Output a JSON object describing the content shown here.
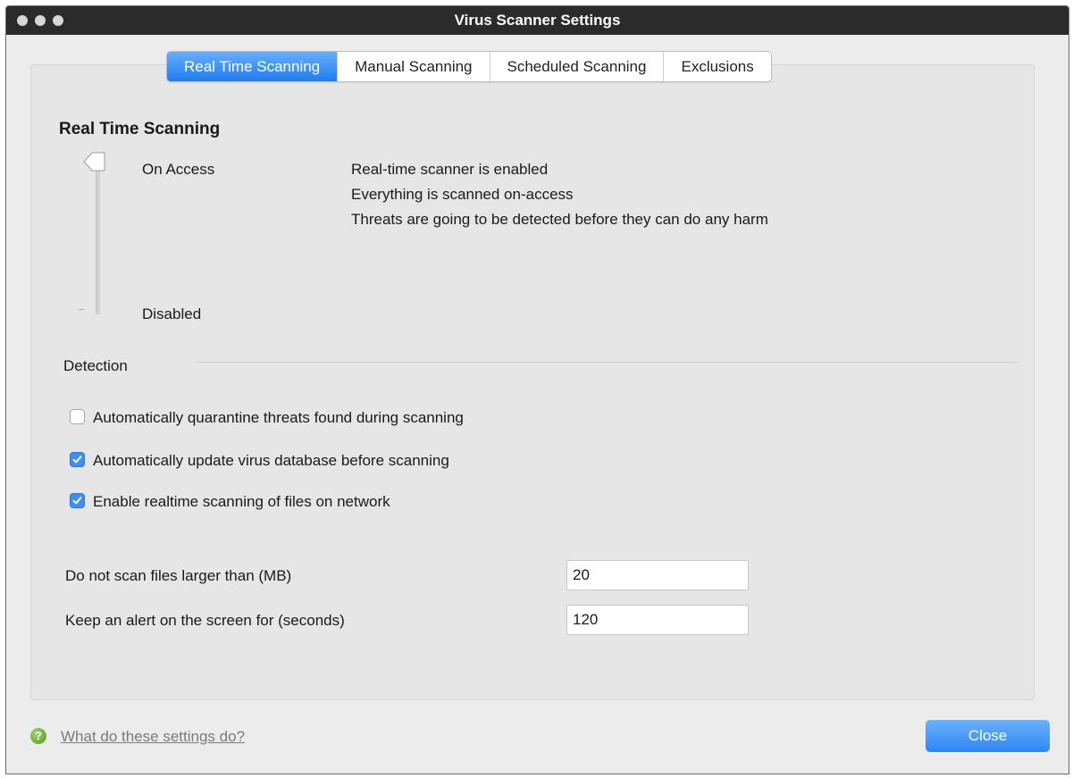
{
  "window": {
    "title": "Virus Scanner Settings"
  },
  "tabs": [
    {
      "label": "Real Time Scanning",
      "active": true
    },
    {
      "label": "Manual Scanning",
      "active": false
    },
    {
      "label": "Scheduled Scanning",
      "active": false
    },
    {
      "label": "Exclusions",
      "active": false
    }
  ],
  "realtime": {
    "heading": "Real Time Scanning",
    "slider": {
      "levels": [
        "On Access",
        "Disabled"
      ],
      "selected": "On Access",
      "description": [
        "Real-time scanner is enabled",
        "Everything is scanned on-access",
        "Threats are going to be detected before they can do any harm"
      ]
    }
  },
  "detection": {
    "heading": "Detection",
    "options": [
      {
        "label": "Automatically quarantine threats found during scanning",
        "checked": false
      },
      {
        "label": "Automatically update virus database before scanning",
        "checked": true
      },
      {
        "label": "Enable realtime scanning of files on network",
        "checked": true
      }
    ]
  },
  "limits": {
    "max_file_size": {
      "label": "Do not scan files larger than (MB)",
      "value": "20"
    },
    "alert_duration": {
      "label": "Keep an alert on the screen for (seconds)",
      "value": "120"
    }
  },
  "footer": {
    "help_link": "What do these settings do?",
    "close_label": "Close"
  },
  "colors": {
    "accent": "#2d86f3",
    "titlebar": "#2b2b2b",
    "help_icon": "#4e9a1f"
  }
}
